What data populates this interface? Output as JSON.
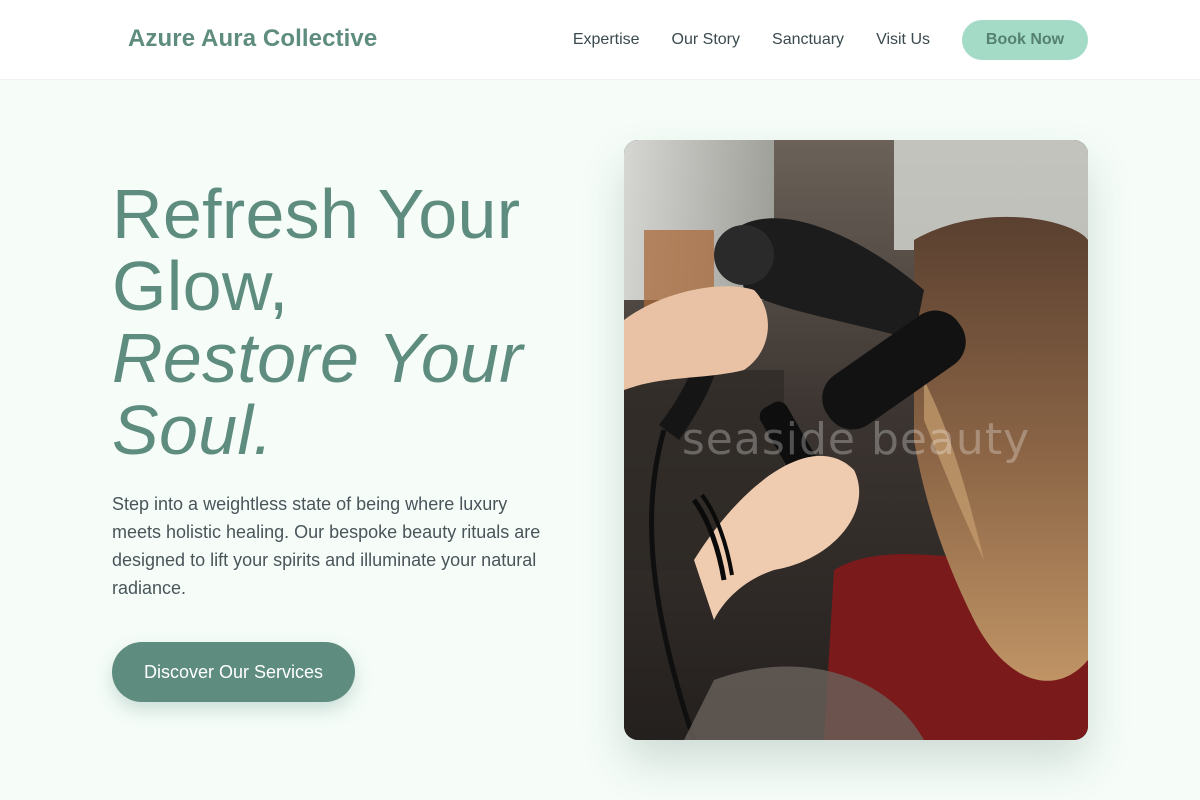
{
  "header": {
    "brand": "Azure Aura Collective",
    "nav": [
      {
        "label": "Expertise"
      },
      {
        "label": "Our Story"
      },
      {
        "label": "Sanctuary"
      },
      {
        "label": "Visit Us"
      }
    ],
    "cta_label": "Book Now"
  },
  "hero": {
    "title_line1": "Refresh Your",
    "title_line2": "Glow,",
    "title_line3": "Restore Your",
    "title_line4": "Soul.",
    "description": "Step into a weightless state of being where luxury meets holistic healing. Our bespoke beauty rituals are designed to lift your spirits and illuminate your natural radiance.",
    "cta_label": "Discover Our Services",
    "image_watermark": "seaside beauty"
  },
  "colors": {
    "brand": "#5e8c7e",
    "button_mint": "#a3dbc7",
    "page_background": "#f6fdf9"
  },
  "icons": {
    "hero_image": "hair-salon-photo"
  }
}
